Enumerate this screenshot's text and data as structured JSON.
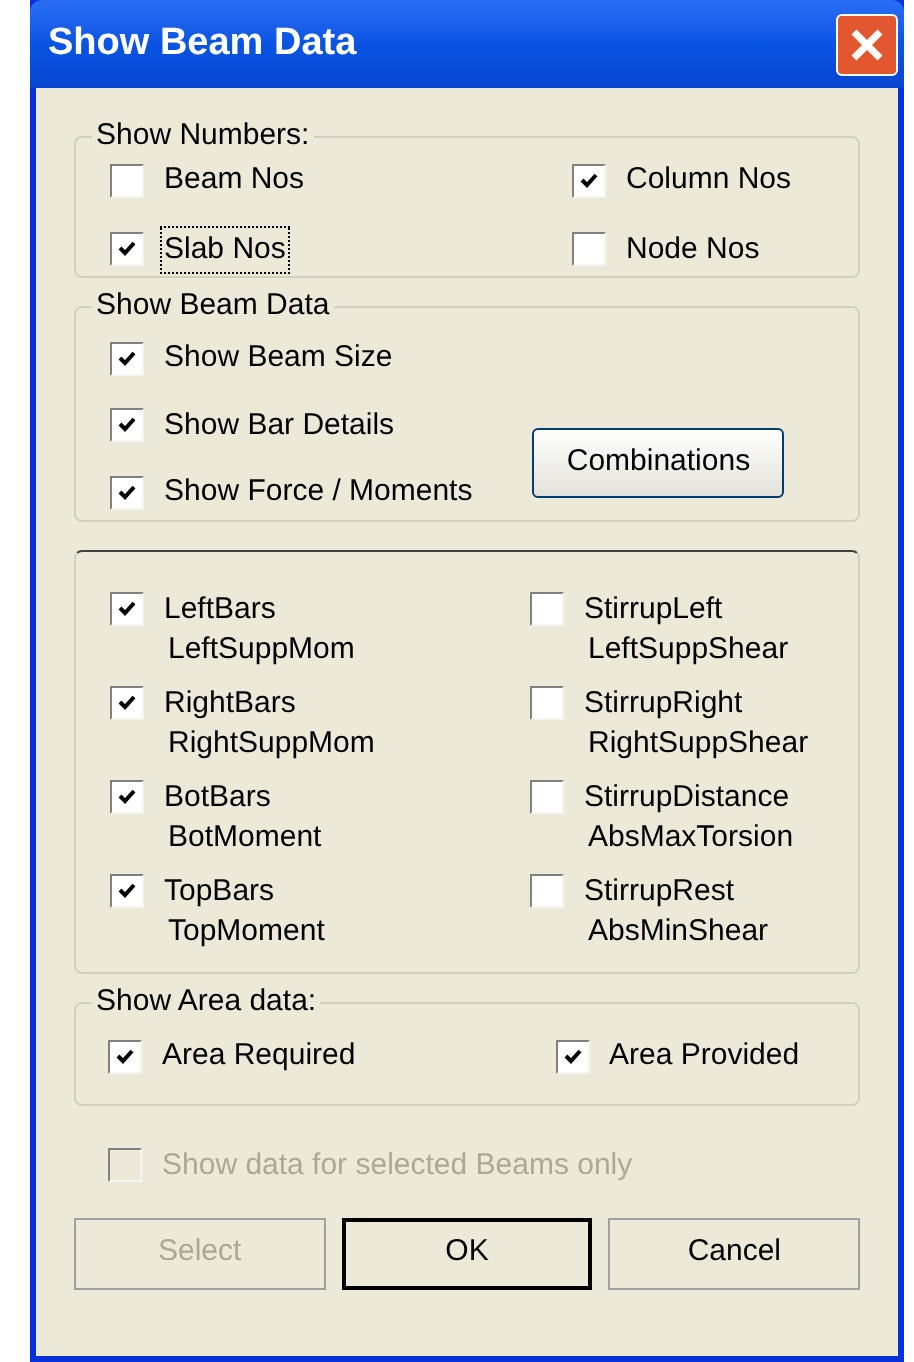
{
  "window": {
    "title": "Show Beam Data"
  },
  "show_numbers": {
    "title": "Show Numbers:",
    "items": [
      {
        "label": "Beam Nos",
        "checked": false,
        "focused": false
      },
      {
        "label": "Column Nos",
        "checked": true,
        "focused": false
      },
      {
        "label": "Slab Nos",
        "checked": true,
        "focused": true
      },
      {
        "label": "Node Nos",
        "checked": false,
        "focused": false
      }
    ]
  },
  "show_beam_data": {
    "title": "Show Beam Data",
    "items": [
      {
        "label": "Show Beam Size",
        "checked": true
      },
      {
        "label": "Show Bar Details",
        "checked": true
      },
      {
        "label": "Show Force / Moments",
        "checked": true
      }
    ],
    "button": "Combinations"
  },
  "bar_options": [
    {
      "label": "LeftBars",
      "sublabel": "LeftSuppMom",
      "checked": true
    },
    {
      "label": "StirrupLeft",
      "sublabel": "LeftSuppShear",
      "checked": false
    },
    {
      "label": "RightBars",
      "sublabel": "RightSuppMom",
      "checked": true
    },
    {
      "label": "StirrupRight",
      "sublabel": "RightSuppShear",
      "checked": false
    },
    {
      "label": "BotBars",
      "sublabel": "BotMoment",
      "checked": true
    },
    {
      "label": "StirrupDistance",
      "sublabel": "AbsMaxTorsion",
      "checked": false
    },
    {
      "label": "TopBars",
      "sublabel": "TopMoment",
      "checked": true
    },
    {
      "label": "StirrupRest",
      "sublabel": "AbsMinShear",
      "checked": false
    }
  ],
  "show_area_data": {
    "title": "Show Area data:",
    "items": [
      {
        "label": "Area Required",
        "checked": true
      },
      {
        "label": "Area Provided",
        "checked": true
      }
    ]
  },
  "selected_only": {
    "label": "Show data for selected Beams only",
    "checked": false,
    "disabled": true
  },
  "buttons": [
    {
      "label": "Select",
      "disabled": true,
      "default": false
    },
    {
      "label": "OK",
      "disabled": false,
      "default": true
    },
    {
      "label": "Cancel",
      "disabled": false,
      "default": false
    }
  ]
}
